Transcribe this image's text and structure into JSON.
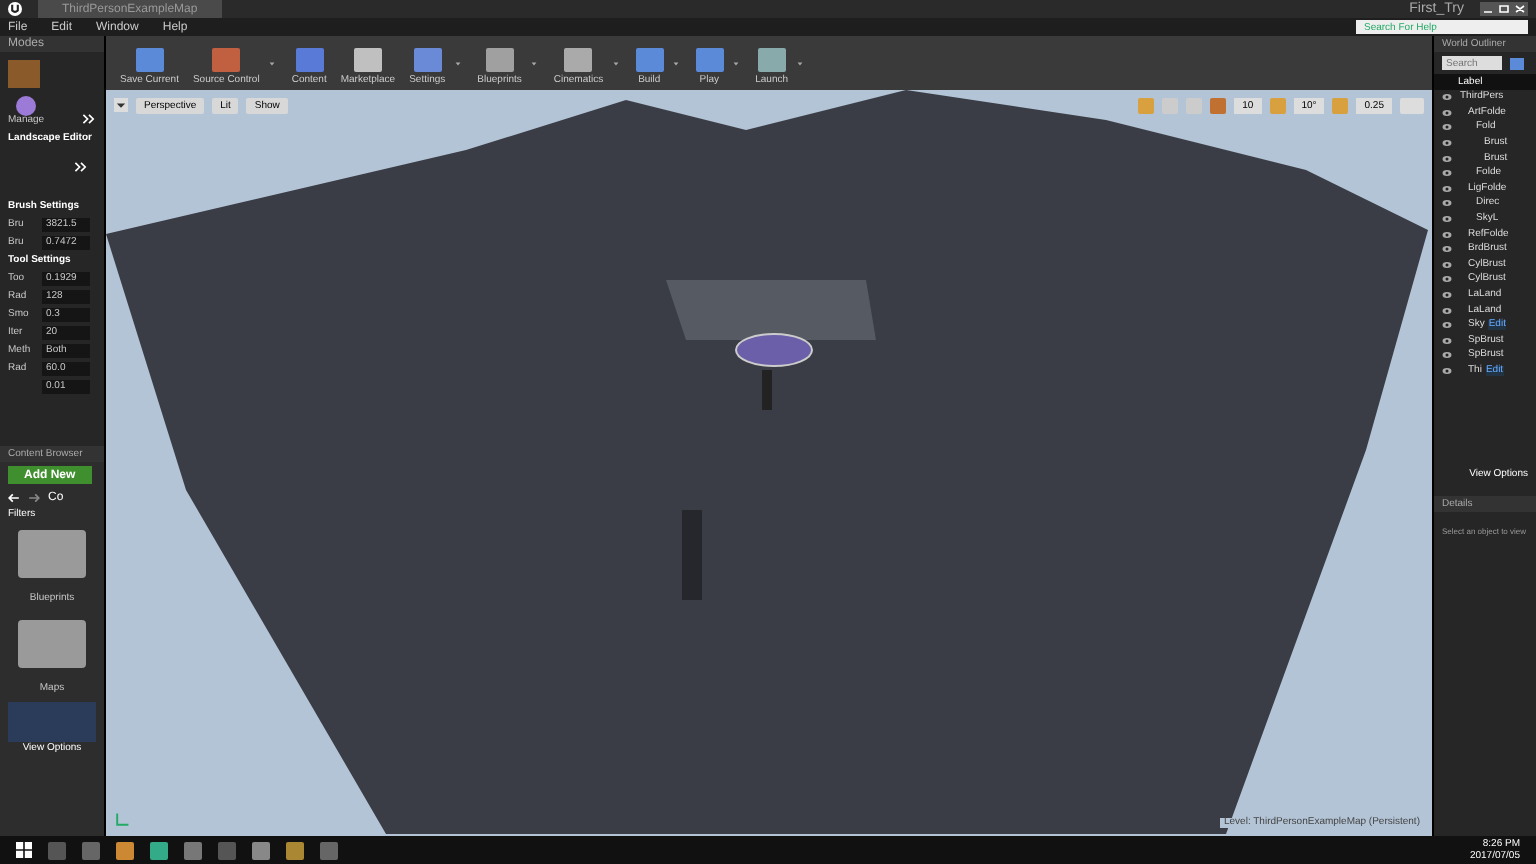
{
  "window": {
    "tab": "ThirdPersonExampleMap",
    "project": "First_Try",
    "help_search": {
      "placeholder": "Search For Help"
    }
  },
  "menu": [
    "File",
    "Edit",
    "Window",
    "Help"
  ],
  "modes": {
    "title": "Modes",
    "manage": "Manage",
    "panel": "Landscape Editor",
    "sections": [
      {
        "title": "Brush Settings",
        "fields": [
          {
            "label": "Bru",
            "value": "3821.5"
          },
          {
            "label": "Bru",
            "value": "0.7472"
          }
        ]
      },
      {
        "title": "Tool Settings",
        "fields": [
          {
            "label": "Too",
            "value": "0.1929"
          },
          {
            "label": "Rad",
            "value": "128"
          },
          {
            "label": "Smo",
            "value": "0.3"
          },
          {
            "label": "Iter",
            "value": "20"
          },
          {
            "label": "Meth",
            "value": "Both"
          },
          {
            "label": "Rad",
            "value": "60.0"
          },
          {
            "value": "0.01"
          }
        ]
      }
    ]
  },
  "content_browser": {
    "title": "Content Browser",
    "add_new": "Add New",
    "path": "Co",
    "filters": "Filters",
    "folders": [
      "Blueprints",
      "Maps"
    ],
    "view_options": "View Options"
  },
  "toolbar": [
    {
      "label": "Save Current",
      "dropdown": false
    },
    {
      "label": "Source Control",
      "dropdown": true
    },
    {
      "label": "Content",
      "dropdown": false
    },
    {
      "label": "Marketplace",
      "dropdown": false
    },
    {
      "label": "Settings",
      "dropdown": true
    },
    {
      "label": "Blueprints",
      "dropdown": true
    },
    {
      "label": "Cinematics",
      "dropdown": true
    },
    {
      "label": "Build",
      "dropdown": true
    },
    {
      "label": "Play",
      "dropdown": true
    },
    {
      "label": "Launch",
      "dropdown": true
    }
  ],
  "viewport": {
    "buttons": [
      "Perspective",
      "Lit",
      "Show"
    ],
    "grid": "10",
    "rotation": "10°",
    "scale": "0.25",
    "level": "Level:  ThirdPersonExampleMap (Persistent)"
  },
  "outliner": {
    "title": "World Outliner",
    "search": {
      "placeholder": "Search"
    },
    "column": "Label",
    "tree": [
      {
        "label": "ThirdPers",
        "children": [
          {
            "label": "ArtFolde",
            "children": [
              {
                "label": "Fold",
                "children": [
                  {
                    "label": "Brust"
                  },
                  {
                    "label": "Brust"
                  }
                ]
              },
              {
                "label": "Folde"
              }
            ]
          },
          {
            "label": "LigFolde",
            "children": [
              {
                "label": "Direc"
              },
              {
                "label": "SkyL"
              }
            ]
          },
          {
            "label": "RefFolde"
          },
          {
            "label": "BrdBrust"
          },
          {
            "label": "CylBrust"
          },
          {
            "label": "CylBrust"
          },
          {
            "label": "LaLand"
          },
          {
            "label": "LaLand"
          },
          {
            "label": "Sky",
            "edit": "Edit"
          },
          {
            "label": "SpBrust"
          },
          {
            "label": "SpBrust"
          },
          {
            "label": "Thi",
            "edit": "Edit"
          }
        ]
      }
    ],
    "view_options": "View Options"
  },
  "details": {
    "title": "Details",
    "hint": "Select an object to view"
  },
  "taskbar": {
    "time": "8:26 PM",
    "date": "2017/07/05"
  }
}
